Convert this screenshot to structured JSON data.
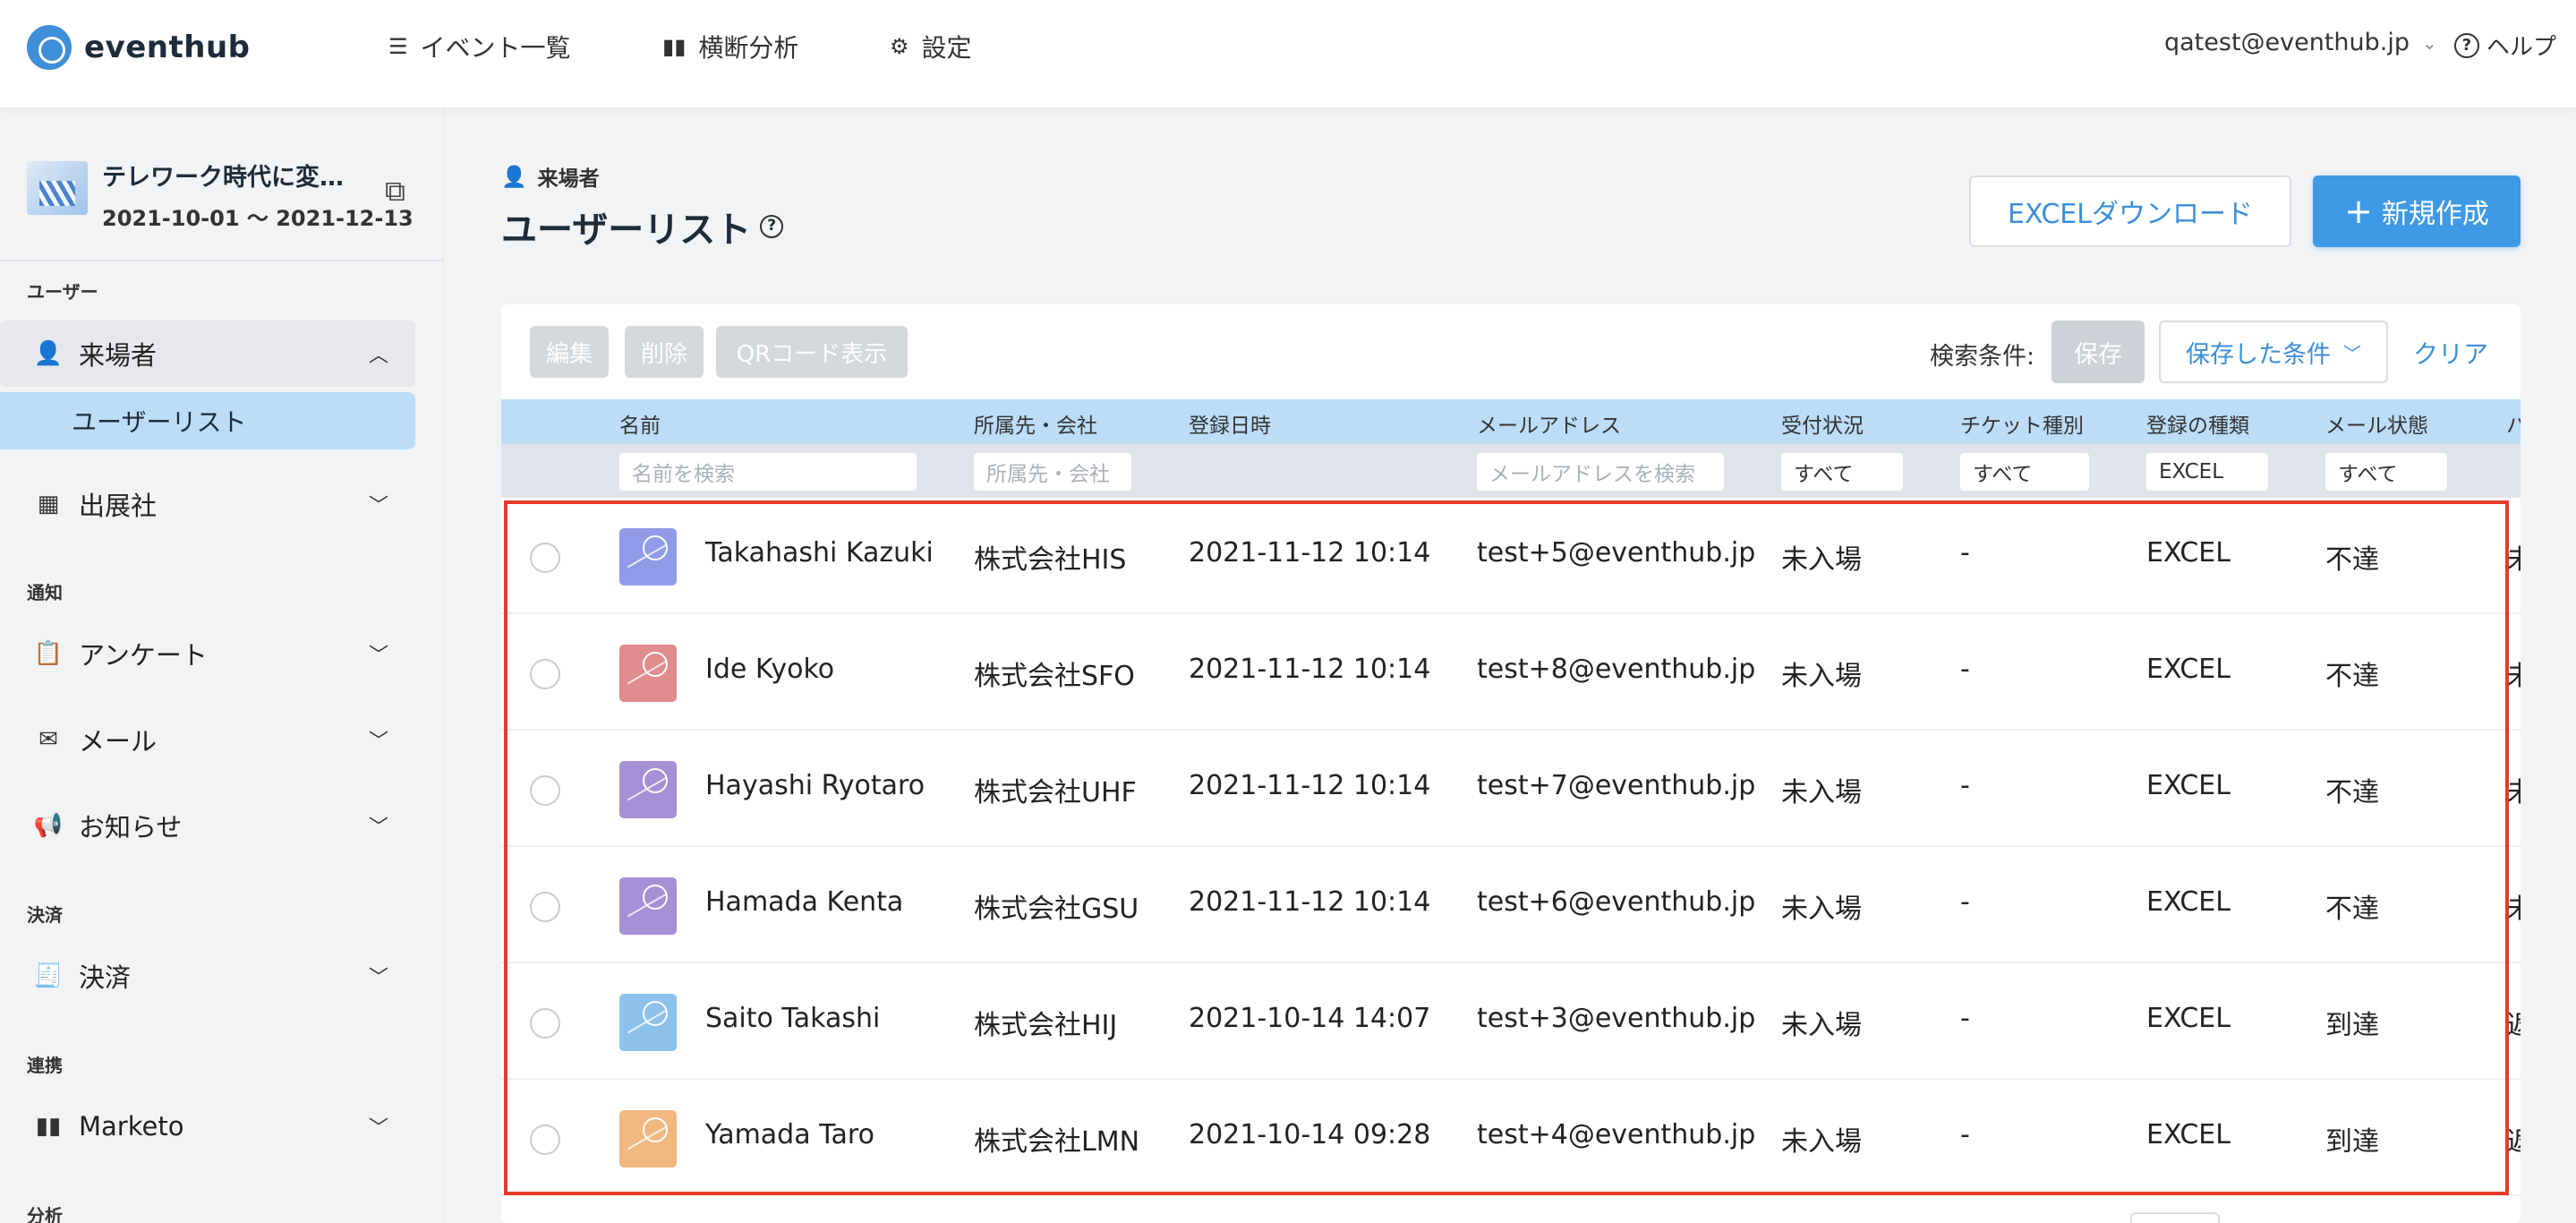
{
  "nav": {
    "logo_text": "eventhub",
    "items": [
      {
        "label": "イベント一覧",
        "icon": "list-icon"
      },
      {
        "label": "横断分析",
        "icon": "bar-chart-icon"
      },
      {
        "label": "設定",
        "icon": "gear-icon"
      }
    ],
    "user_email": "qatest@eventhub.jp",
    "help_label": "ヘルプ"
  },
  "sidebar": {
    "event": {
      "title": "テレワーク時代に変…",
      "date": "2021-10-01 〜 2021-12-13"
    },
    "sections": {
      "user": "ユーザー",
      "notice": "通知",
      "payment": "決済",
      "integration": "連携",
      "analysis": "分析"
    },
    "items": {
      "visitors": "来場者",
      "user_list": "ユーザーリスト",
      "exhibitors": "出展社",
      "survey": "アンケート",
      "mail": "メール",
      "news": "お知らせ",
      "payment": "決済",
      "marketo": "Marketo"
    }
  },
  "header": {
    "breadcrumb": "来場者",
    "title": "ユーザーリスト",
    "excel_button": "EXCELダウンロード",
    "new_button": "新規作成"
  },
  "toolbar": {
    "edit": "編集",
    "delete": "削除",
    "qr": "QRコード表示",
    "search_label": "検索条件:",
    "save": "保存",
    "saved_conditions": "保存した条件",
    "clear": "クリア"
  },
  "table": {
    "columns": [
      "名前",
      "所属先・会社",
      "登録日時",
      "メールアドレス",
      "受付状況",
      "チケット種別",
      "登録の種類",
      "メール状態",
      "ハ"
    ],
    "filters": {
      "name_placeholder": "名前を検索",
      "company_placeholder": "所属先・会社",
      "email_placeholder": "メールアドレスを検索",
      "reception": "すべて",
      "ticket": "すべて",
      "registration": "EXCEL",
      "mail_status": "すべて"
    },
    "rows": [
      {
        "name": "Takahashi Kazuki",
        "company": "株式会社HIS",
        "date": "2021-11-12 10:14",
        "email": "test+5@eventhub.jp",
        "reception": "未入場",
        "ticket": "-",
        "registration": "EXCEL",
        "mail_status": "不達",
        "extra": "未",
        "avatar_color": "#8f9be8"
      },
      {
        "name": "Ide Kyoko",
        "company": "株式会社SFO",
        "date": "2021-11-12 10:14",
        "email": "test+8@eventhub.jp",
        "reception": "未入場",
        "ticket": "-",
        "registration": "EXCEL",
        "mail_status": "不達",
        "extra": "未",
        "avatar_color": "#e08c8c"
      },
      {
        "name": "Hayashi Ryotaro",
        "company": "株式会社UHF",
        "date": "2021-11-12 10:14",
        "email": "test+7@eventhub.jp",
        "reception": "未入場",
        "ticket": "-",
        "registration": "EXCEL",
        "mail_status": "不達",
        "extra": "未",
        "avatar_color": "#a68fd4"
      },
      {
        "name": "Hamada Kenta",
        "company": "株式会社GSU",
        "date": "2021-11-12 10:14",
        "email": "test+6@eventhub.jp",
        "reception": "未入場",
        "ticket": "-",
        "registration": "EXCEL",
        "mail_status": "不達",
        "extra": "未",
        "avatar_color": "#a68fd4"
      },
      {
        "name": "Saito Takashi",
        "company": "株式会社HIJ",
        "date": "2021-10-14 14:07",
        "email": "test+3@eventhub.jp",
        "reception": "未入場",
        "ticket": "-",
        "registration": "EXCEL",
        "mail_status": "到達",
        "extra": "返",
        "avatar_color": "#8cc1ec"
      },
      {
        "name": "Yamada Taro",
        "company": "株式会社LMN",
        "date": "2021-10-14 09:28",
        "email": "test+4@eventhub.jp",
        "reception": "未入場",
        "ticket": "-",
        "registration": "EXCEL",
        "mail_status": "到達",
        "extra": "返",
        "avatar_color": "#f0b77e"
      }
    ]
  }
}
